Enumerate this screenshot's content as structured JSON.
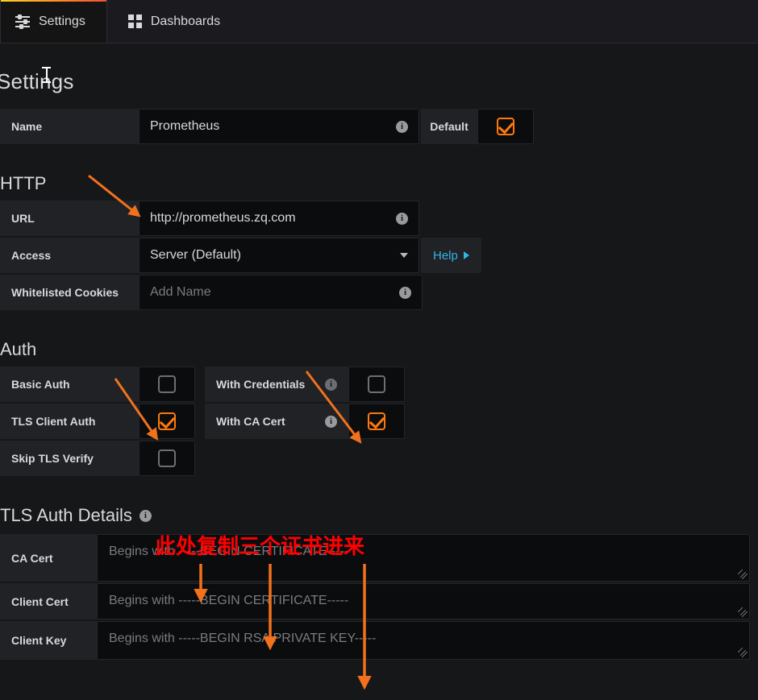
{
  "tabs": [
    {
      "label": "Settings",
      "icon": "sliders-icon",
      "active": true
    },
    {
      "label": "Dashboards",
      "icon": "grid-icon",
      "active": false
    }
  ],
  "page_title": "Settings",
  "name_row": {
    "label": "Name",
    "value": "Prometheus",
    "info_icon": "info-icon",
    "default_label": "Default",
    "default_checked": "checked"
  },
  "http": {
    "title": "HTTP",
    "url": {
      "label": "URL",
      "value": "http://prometheus.zq.com",
      "info_icon": "info-icon"
    },
    "access": {
      "label": "Access",
      "value": "Server (Default)",
      "caret_icon": "chevron-down-icon",
      "help_label": "Help",
      "help_icon": "play-arrow-icon"
    },
    "cookies": {
      "label": "Whitelisted Cookies",
      "placeholder": "Add Name",
      "value": "",
      "info_icon": "info-icon"
    }
  },
  "auth": {
    "title": "Auth",
    "items": [
      {
        "label": "Basic Auth",
        "checked": false,
        "info": false
      },
      {
        "label": "With Credentials",
        "checked": false,
        "info": true
      },
      {
        "label": "TLS Client Auth",
        "checked": true,
        "info": false
      },
      {
        "label": "With CA Cert",
        "checked": true,
        "info": true
      },
      {
        "label": "Skip TLS Verify",
        "checked": false,
        "info": false
      }
    ]
  },
  "tls": {
    "title": "TLS Auth Details",
    "info_icon": "info-icon",
    "fields": [
      {
        "label": "CA Cert",
        "placeholder": "Begins with -----BEGIN CERTIFICATE-----",
        "value": ""
      },
      {
        "label": "Client Cert",
        "placeholder": "Begins with -----BEGIN CERTIFICATE-----",
        "value": ""
      },
      {
        "label": "Client Key",
        "placeholder": "Begins with -----BEGIN RSA PRIVATE KEY-----",
        "value": ""
      }
    ]
  },
  "annotations": {
    "note_text": "此处复制三个证书进来",
    "note_color": "#ff0000",
    "arrow_color": "#f2711c"
  },
  "colors": {
    "accent_orange": "#ff780a",
    "link_blue": "#33b5e5",
    "bg": "#161719",
    "label_bg": "#202226",
    "input_bg": "#0b0c0e"
  }
}
